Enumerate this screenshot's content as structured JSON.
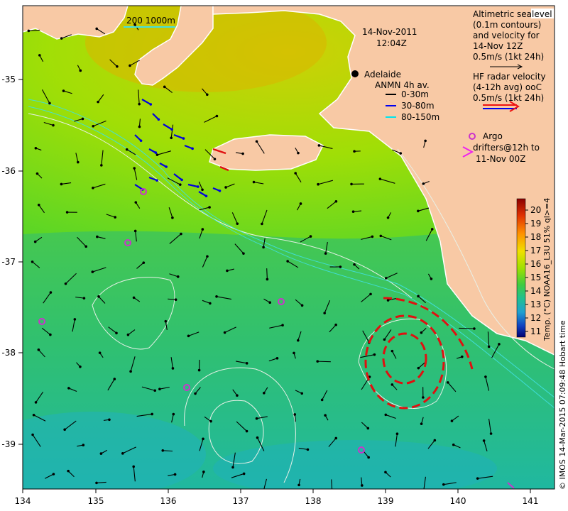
{
  "map": {
    "date": "14-Nov-2011",
    "time": "12:04Z",
    "city": "Adelaide",
    "scale_label": "200  1000m",
    "legend_sealevel": [
      "Altimetric sealevel",
      "(0.1m contours)",
      "and velocity for",
      "14-Nov 12Z",
      "0.5m/s (1kt 24h)"
    ],
    "legend_hf": [
      "HF radar velocity",
      "(4-12h avg) ooC",
      "0.5m/s (1kt 24h)"
    ],
    "legend_anmn_title": "ANMN 4h av.",
    "legend_anmn": [
      {
        "label": "0-30m",
        "color": "#000000"
      },
      {
        "label": "30-80m",
        "color": "#0000ee"
      },
      {
        "label": "80-150m",
        "color": "#00e5ee"
      }
    ],
    "legend_argo": [
      "Argo",
      "drifters@12h to",
      "11-Nov 00Z"
    ],
    "colorbar": {
      "ticks": [
        "20",
        "19",
        "18",
        "17",
        "16",
        "15",
        "14",
        "13",
        "12",
        "11"
      ],
      "label": "Temp. (°C) NOAA16_L3U 51% ql>=4"
    },
    "credit": "© IMOS 14-Mar-2015 07:09:48 Hobart time",
    "x_ticks": [
      "134",
      "135",
      "136",
      "137",
      "138",
      "139",
      "140",
      "141"
    ],
    "y_ticks": [
      "-35",
      "-36",
      "-37",
      "-38",
      "-39"
    ],
    "colors": {
      "land": "#f8c9a5",
      "coast": "#ffffff",
      "argo": "#cc33cc",
      "hf": "#ee1111"
    }
  }
}
